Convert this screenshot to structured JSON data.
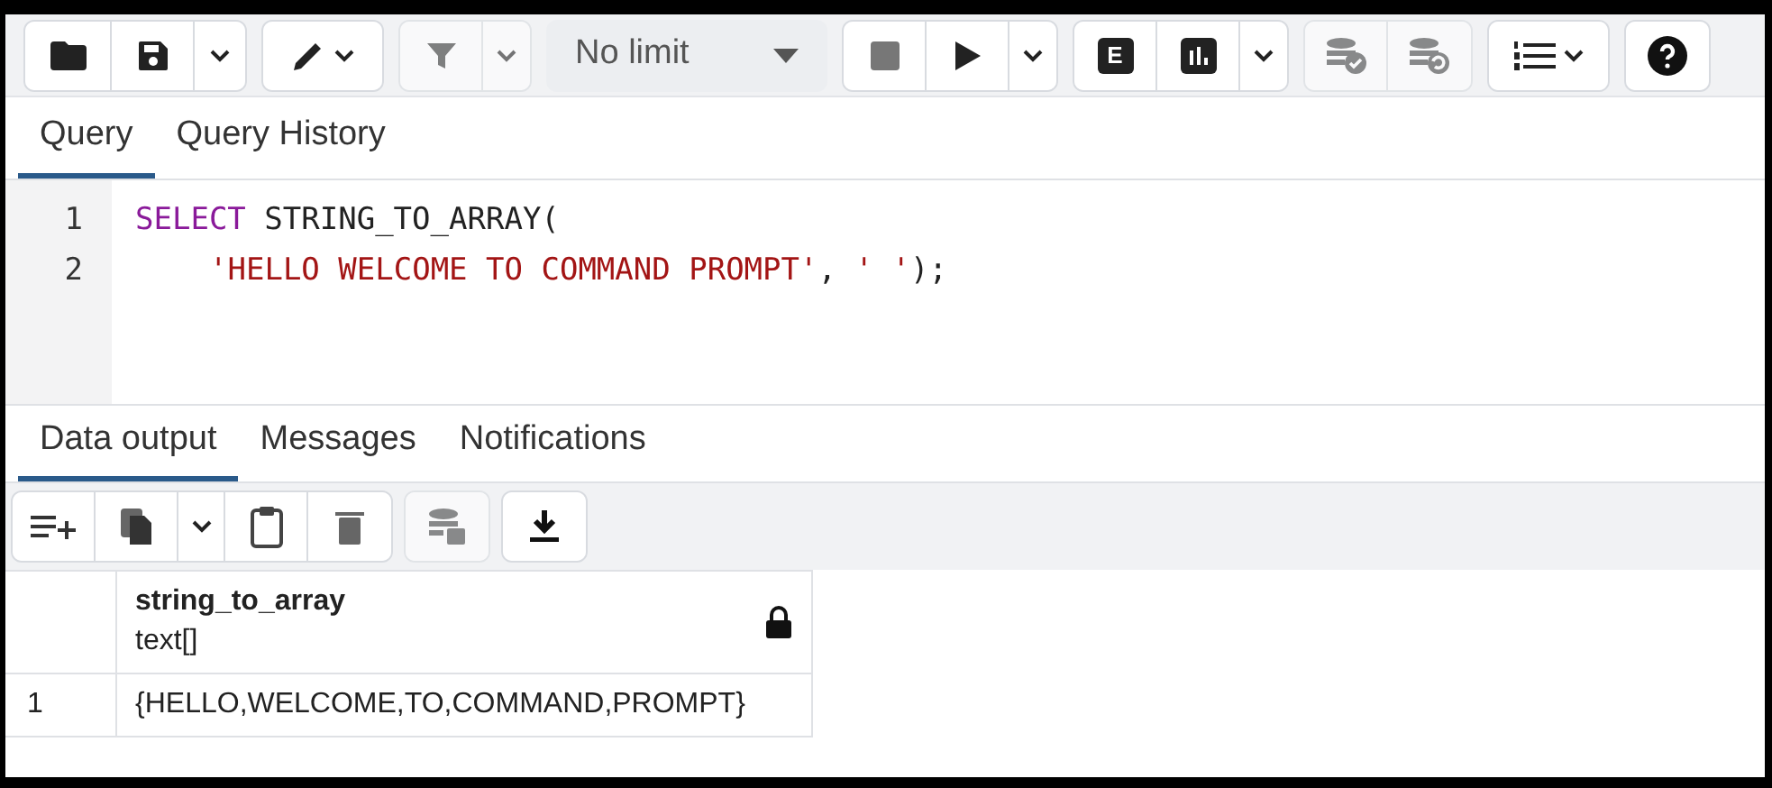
{
  "toolbar": {
    "limit": "No limit",
    "explain_label": "E"
  },
  "editor_tabs": [
    {
      "label": "Query",
      "selected": true
    },
    {
      "label": "Query History",
      "selected": false
    }
  ],
  "code_lines": [
    {
      "number": "1",
      "tokens": [
        {
          "kind": "keyword",
          "text": "SELECT"
        },
        {
          "kind": "plain",
          "text": " STRING_TO_ARRAY("
        }
      ]
    },
    {
      "number": "2",
      "indented": true,
      "tokens": [
        {
          "kind": "string",
          "text": "'HELLO WELCOME TO COMMAND PROMPT'"
        },
        {
          "kind": "plain",
          "text": ", "
        },
        {
          "kind": "string",
          "text": "' '"
        },
        {
          "kind": "plain",
          "text": ");"
        }
      ]
    }
  ],
  "output_tabs": [
    {
      "label": "Data output",
      "selected": true
    },
    {
      "label": "Messages",
      "selected": false
    },
    {
      "label": "Notifications",
      "selected": false
    }
  ],
  "table": {
    "columns": [
      {
        "name": "string_to_array",
        "type": "text[]",
        "locked": true
      }
    ],
    "rows": [
      {
        "number": "1",
        "cells": [
          "{HELLO,WELCOME,TO,COMMAND,PROMPT}"
        ]
      }
    ]
  }
}
